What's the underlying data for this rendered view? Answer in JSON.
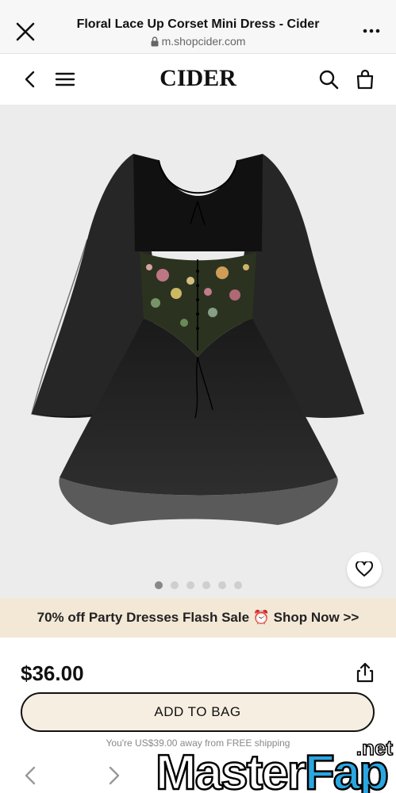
{
  "browser": {
    "title": "Floral Lace Up Corset Mini Dress - Cider",
    "url": "m.shopcider.com",
    "close_icon": "close-icon",
    "more_icon": "more-icon",
    "lock_icon": "lock-icon"
  },
  "header": {
    "logo": "CIDER",
    "back_icon": "chevron-left-icon",
    "menu_icon": "menu-icon",
    "search_icon": "search-icon",
    "bag_icon": "shopping-bag-icon"
  },
  "product": {
    "image_icon": "dress-image",
    "wishlist_icon": "heart-icon",
    "gallery": {
      "count": 6,
      "active_index": 0
    },
    "price": "$36.00",
    "share_icon": "share-icon"
  },
  "promo": {
    "text": "70% off Party Dresses Flash Sale ⏰ Shop Now >>"
  },
  "cart": {
    "add_button": "ADD TO BAG",
    "shipping_note": "You're US$39.00 away from FREE shipping"
  },
  "watermark": {
    "master": "Master",
    "fap": "Fap",
    "net": ".net"
  },
  "colors": {
    "promo_bg": "#f3e8d6",
    "button_bg": "#f7eee2",
    "product_bg": "#ececec",
    "watermark_accent": "#2aa7e0"
  }
}
